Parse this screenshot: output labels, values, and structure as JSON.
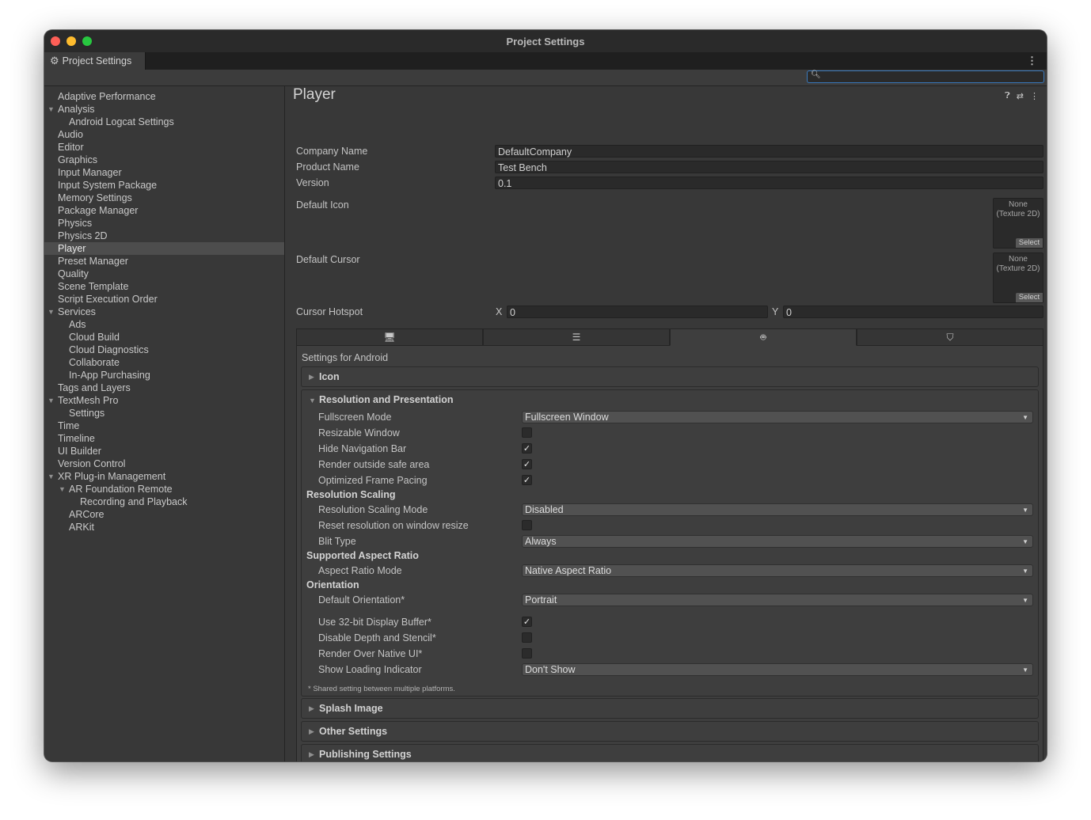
{
  "window": {
    "title": "Project Settings"
  },
  "tab": {
    "label": "Project Settings",
    "icon": "gear-icon"
  },
  "search": {
    "placeholder": ""
  },
  "sidebar": {
    "items": [
      {
        "label": "Adaptive Performance",
        "level": 0
      },
      {
        "label": "Analysis",
        "level": 0,
        "expanded": true
      },
      {
        "label": "Android Logcat Settings",
        "level": 1
      },
      {
        "label": "Audio",
        "level": 0
      },
      {
        "label": "Editor",
        "level": 0
      },
      {
        "label": "Graphics",
        "level": 0
      },
      {
        "label": "Input Manager",
        "level": 0
      },
      {
        "label": "Input System Package",
        "level": 0
      },
      {
        "label": "Memory Settings",
        "level": 0
      },
      {
        "label": "Package Manager",
        "level": 0
      },
      {
        "label": "Physics",
        "level": 0
      },
      {
        "label": "Physics 2D",
        "level": 0
      },
      {
        "label": "Player",
        "level": 0,
        "selected": true
      },
      {
        "label": "Preset Manager",
        "level": 0
      },
      {
        "label": "Quality",
        "level": 0
      },
      {
        "label": "Scene Template",
        "level": 0
      },
      {
        "label": "Script Execution Order",
        "level": 0
      },
      {
        "label": "Services",
        "level": 0,
        "expanded": true
      },
      {
        "label": "Ads",
        "level": 1
      },
      {
        "label": "Cloud Build",
        "level": 1
      },
      {
        "label": "Cloud Diagnostics",
        "level": 1
      },
      {
        "label": "Collaborate",
        "level": 1
      },
      {
        "label": "In-App Purchasing",
        "level": 1
      },
      {
        "label": "Tags and Layers",
        "level": 0
      },
      {
        "label": "TextMesh Pro",
        "level": 0,
        "expanded": true
      },
      {
        "label": "Settings",
        "level": 1
      },
      {
        "label": "Time",
        "level": 0
      },
      {
        "label": "Timeline",
        "level": 0
      },
      {
        "label": "UI Builder",
        "level": 0
      },
      {
        "label": "Version Control",
        "level": 0
      },
      {
        "label": "XR Plug-in Management",
        "level": 0,
        "expanded": true
      },
      {
        "label": "AR Foundation Remote",
        "level": 1,
        "expanded": true
      },
      {
        "label": "Recording and Playback",
        "level": 2
      },
      {
        "label": "ARCore",
        "level": 1
      },
      {
        "label": "ARKit",
        "level": 1
      }
    ]
  },
  "player": {
    "title": "Player",
    "company_label": "Company Name",
    "company_value": "DefaultCompany",
    "product_label": "Product Name",
    "product_value": "Test Bench",
    "version_label": "Version",
    "version_value": "0.1",
    "icon_label": "Default Icon",
    "cursor_label": "Default Cursor",
    "object_none": "None",
    "object_type": "(Texture 2D)",
    "select_label": "Select",
    "hotspot_label": "Cursor Hotspot",
    "x_label": "X",
    "x_value": "0",
    "y_label": "Y",
    "y_value": "0"
  },
  "platforms": {
    "tabs": [
      "monitor-icon",
      "server-icon",
      "android-icon",
      "html5-icon"
    ],
    "active": 2,
    "settings_label": "Settings for Android"
  },
  "sections": {
    "icon": "Icon",
    "resolution": "Resolution and Presentation",
    "splash": "Splash Image",
    "other": "Other Settings",
    "publishing": "Publishing Settings"
  },
  "resolution": {
    "fullscreen_mode_label": "Fullscreen Mode",
    "fullscreen_mode_value": "Fullscreen Window",
    "resizable_label": "Resizable Window",
    "resizable": false,
    "hide_nav_label": "Hide Navigation Bar",
    "hide_nav": true,
    "render_outside_label": "Render outside safe area",
    "render_outside": true,
    "frame_pacing_label": "Optimized Frame Pacing",
    "frame_pacing": true,
    "scaling_header": "Resolution Scaling",
    "scaling_mode_label": "Resolution Scaling Mode",
    "scaling_mode_value": "Disabled",
    "reset_res_label": "Reset resolution on window resize",
    "reset_res": false,
    "blit_label": "Blit Type",
    "blit_value": "Always",
    "aspect_header": "Supported Aspect Ratio",
    "aspect_mode_label": "Aspect Ratio Mode",
    "aspect_mode_value": "Native Aspect Ratio",
    "orientation_header": "Orientation",
    "default_orientation_label": "Default Orientation*",
    "default_orientation_value": "Portrait",
    "display32_label": "Use 32-bit Display Buffer*",
    "display32": true,
    "depth_label": "Disable Depth and Stencil*",
    "depth": false,
    "native_ui_label": "Render Over Native UI*",
    "native_ui": false,
    "loading_label": "Show Loading Indicator",
    "loading_value": "Don't Show",
    "shared_note": "* Shared setting between multiple platforms."
  },
  "colors": {
    "accent": "#3a79bb",
    "selected_row": "#4d4d4d",
    "panel": "#383838"
  }
}
